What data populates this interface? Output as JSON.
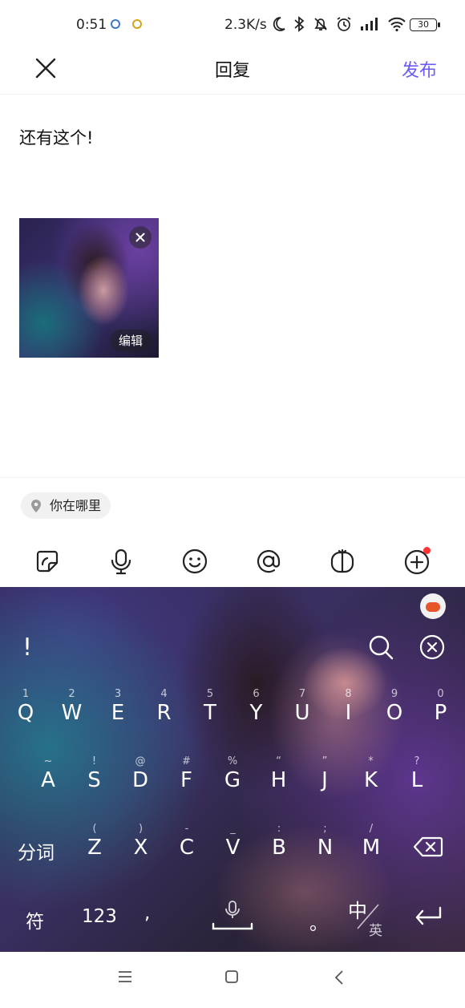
{
  "status": {
    "time": "0:51",
    "speed": "2.3K/s",
    "battery": "30"
  },
  "header": {
    "title": "回复",
    "publish": "发布"
  },
  "post": {
    "text": "还有这个!",
    "image_edit": "编辑"
  },
  "location": {
    "label": "你在哪里"
  },
  "keyboard": {
    "row1": [
      {
        "k": "Q",
        "h": "1"
      },
      {
        "k": "W",
        "h": "2"
      },
      {
        "k": "E",
        "h": "3"
      },
      {
        "k": "R",
        "h": "4"
      },
      {
        "k": "T",
        "h": "5"
      },
      {
        "k": "Y",
        "h": "6"
      },
      {
        "k": "U",
        "h": "7"
      },
      {
        "k": "I",
        "h": "8"
      },
      {
        "k": "O",
        "h": "9"
      },
      {
        "k": "P",
        "h": "0"
      }
    ],
    "row2": [
      {
        "k": "A",
        "h": "~"
      },
      {
        "k": "S",
        "h": "!"
      },
      {
        "k": "D",
        "h": "@"
      },
      {
        "k": "F",
        "h": "#"
      },
      {
        "k": "G",
        "h": "%"
      },
      {
        "k": "H",
        "h": "“"
      },
      {
        "k": "J",
        "h": "”"
      },
      {
        "k": "K",
        "h": "*"
      },
      {
        "k": "L",
        "h": "?"
      }
    ],
    "row3": [
      {
        "k": "Z",
        "h": "("
      },
      {
        "k": "X",
        "h": ")"
      },
      {
        "k": "C",
        "h": "-"
      },
      {
        "k": "V",
        "h": "_"
      },
      {
        "k": "B",
        "h": ":"
      },
      {
        "k": "N",
        "h": ";"
      },
      {
        "k": "M",
        "h": "/"
      }
    ],
    "exclaim": "!",
    "segment": "分词",
    "symbols": "符",
    "numbers": "123",
    "comma": ",",
    "period": "。",
    "lang_main": "中",
    "lang_alt": "英"
  },
  "colors": {
    "accent": "#6a5cf2",
    "badge": "#ff3333"
  }
}
